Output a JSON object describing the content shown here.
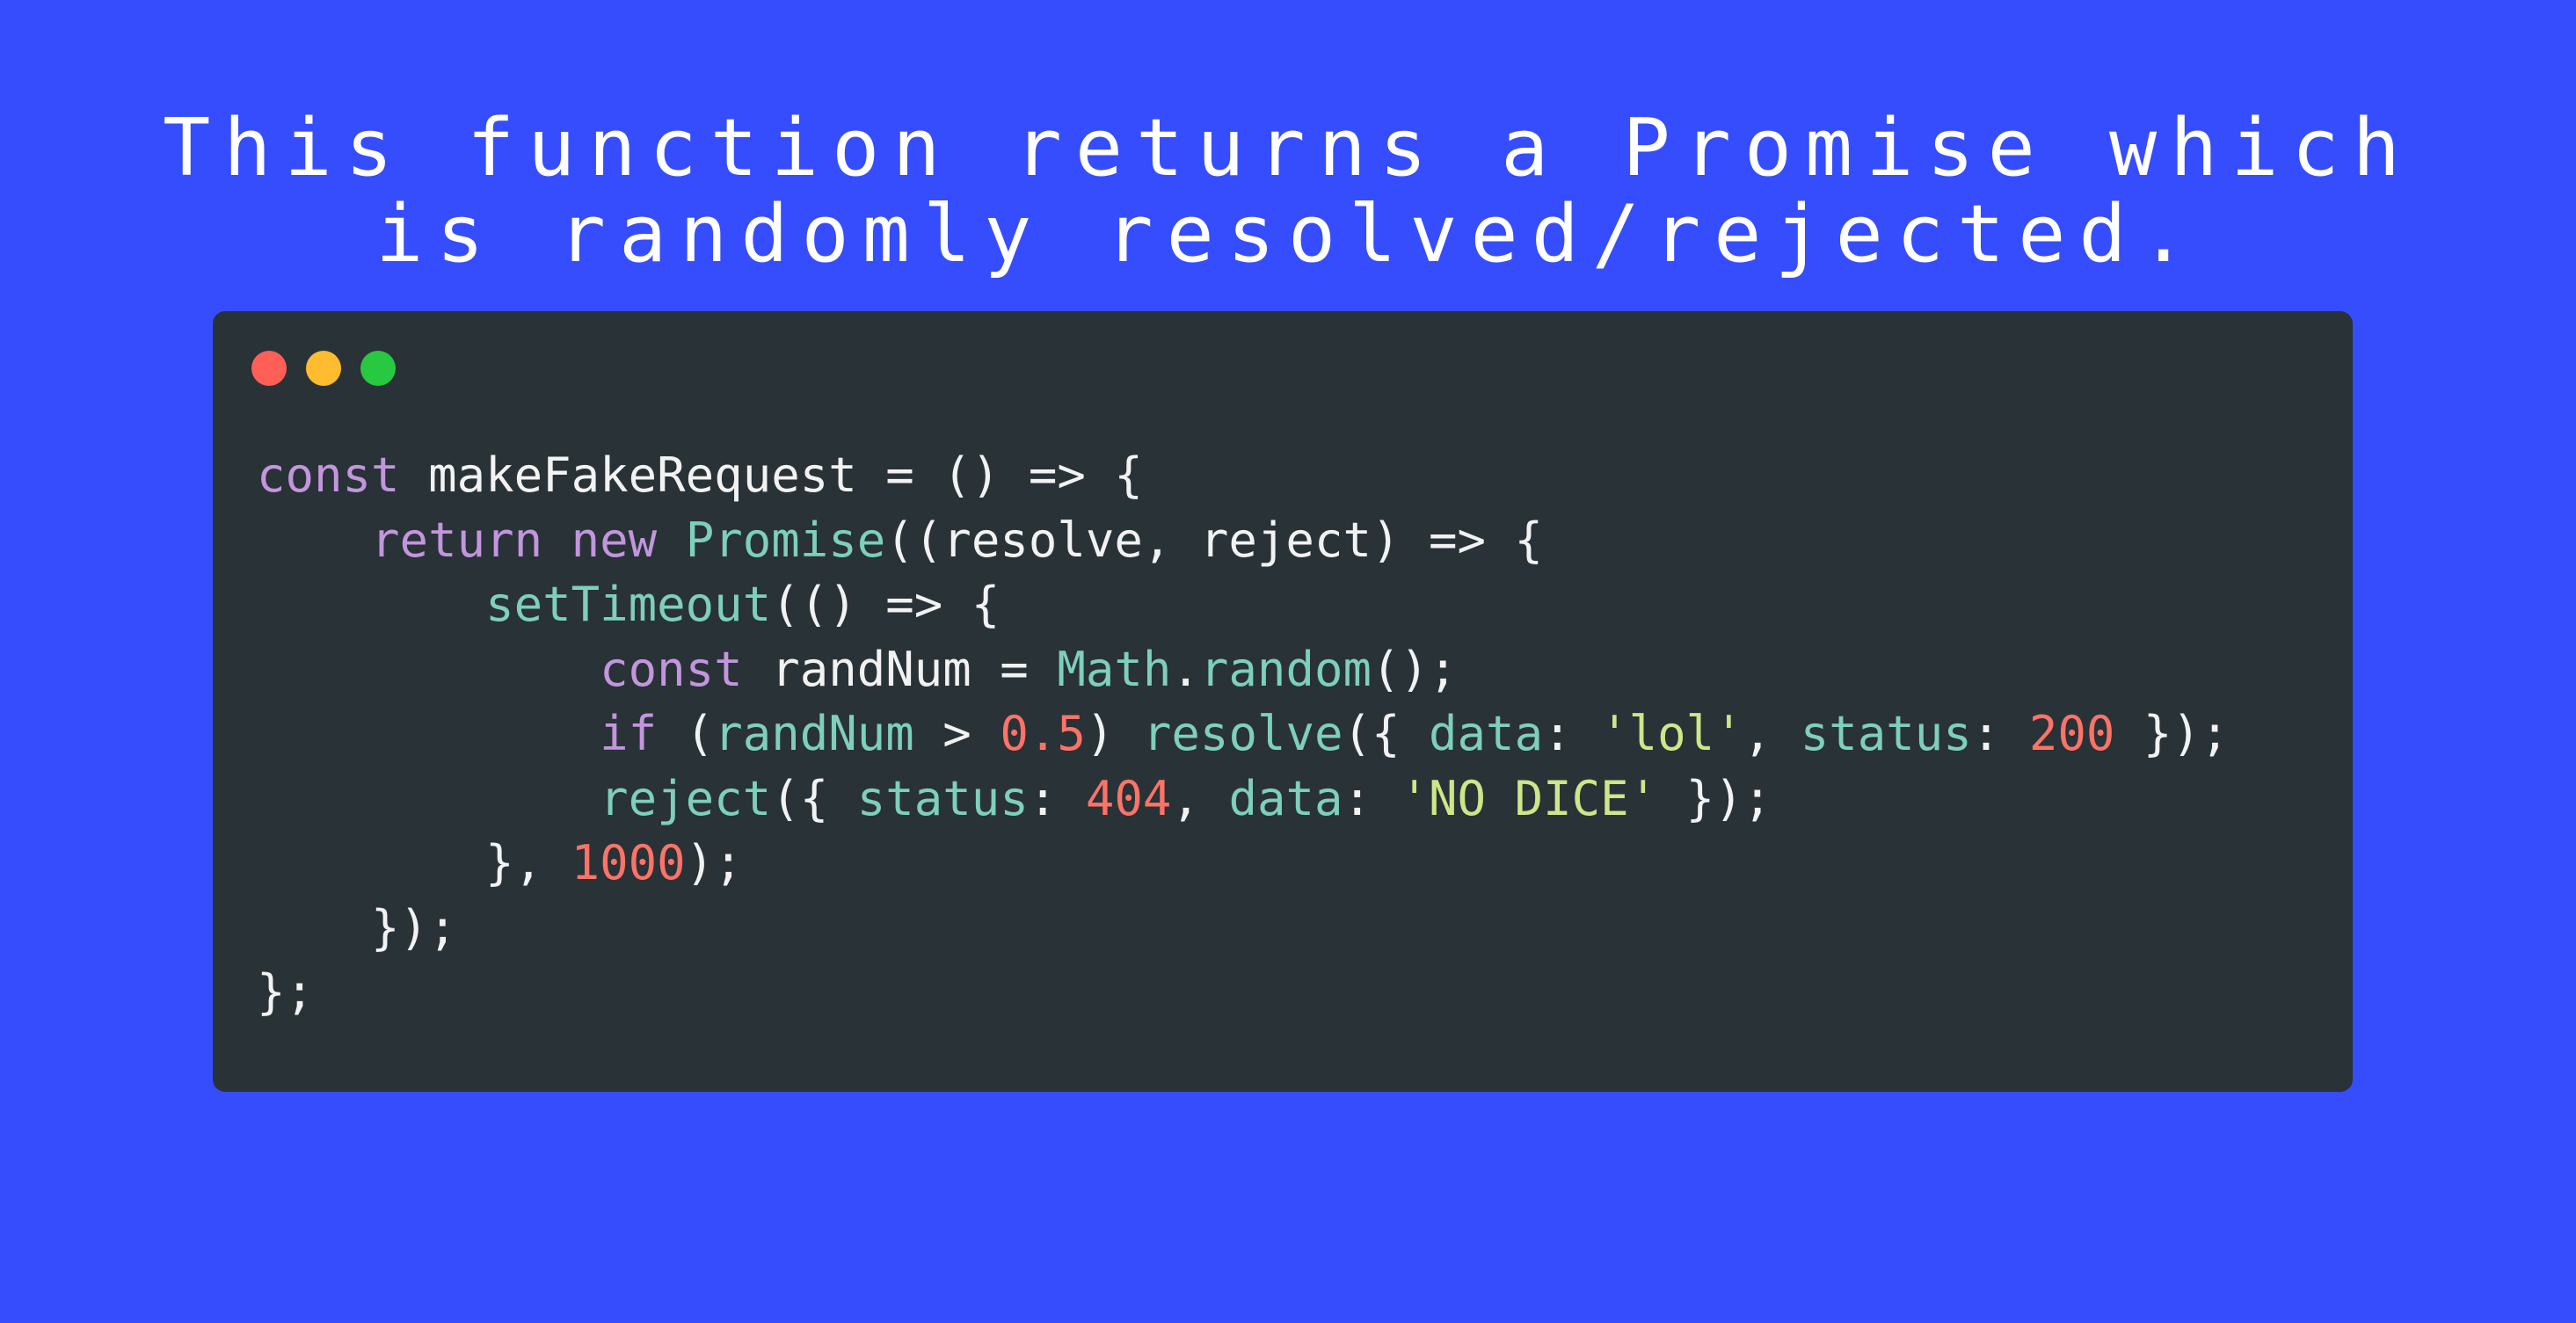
{
  "caption": {
    "line1": "This function returns a Promise which",
    "line2": "is randomly resolved/rejected."
  },
  "window_controls": [
    {
      "name": "close",
      "color": "#ff5f57"
    },
    {
      "name": "minimize",
      "color": "#febc2e"
    },
    {
      "name": "zoom",
      "color": "#28c840"
    }
  ],
  "colors": {
    "background": "#364dfd",
    "code_background": "#293237",
    "keyword": "#c296dd",
    "function": "#7ecfbb",
    "number": "#fc7368",
    "string": "#cfe58a",
    "plain": "#f2f2f2"
  },
  "code": {
    "lines": [
      [
        {
          "t": "const",
          "c": "kw"
        },
        {
          "t": " ",
          "c": "pl"
        },
        {
          "t": "makeFakeRequest",
          "c": "id"
        },
        {
          "t": " = () => {",
          "c": "pl"
        }
      ],
      [
        {
          "t": "    ",
          "c": "pl"
        },
        {
          "t": "return",
          "c": "kw"
        },
        {
          "t": " ",
          "c": "pl"
        },
        {
          "t": "new",
          "c": "kw"
        },
        {
          "t": " ",
          "c": "pl"
        },
        {
          "t": "Promise",
          "c": "fn"
        },
        {
          "t": "((resolve, reject) => {",
          "c": "pl"
        }
      ],
      [
        {
          "t": "        ",
          "c": "pl"
        },
        {
          "t": "setTimeout",
          "c": "fn"
        },
        {
          "t": "(() => {",
          "c": "pl"
        }
      ],
      [
        {
          "t": "            ",
          "c": "pl"
        },
        {
          "t": "const",
          "c": "kw"
        },
        {
          "t": " ",
          "c": "pl"
        },
        {
          "t": "randNum",
          "c": "id"
        },
        {
          "t": " = ",
          "c": "pl"
        },
        {
          "t": "Math",
          "c": "fn"
        },
        {
          "t": ".",
          "c": "pl"
        },
        {
          "t": "random",
          "c": "fn"
        },
        {
          "t": "();",
          "c": "pl"
        }
      ],
      [
        {
          "t": "            ",
          "c": "pl"
        },
        {
          "t": "if",
          "c": "kw"
        },
        {
          "t": " (",
          "c": "pl"
        },
        {
          "t": "randNum",
          "c": "fn"
        },
        {
          "t": " > ",
          "c": "pl"
        },
        {
          "t": "0.5",
          "c": "num"
        },
        {
          "t": ") ",
          "c": "pl"
        },
        {
          "t": "resolve",
          "c": "fn"
        },
        {
          "t": "({ ",
          "c": "pl"
        },
        {
          "t": "data",
          "c": "fn"
        },
        {
          "t": ": ",
          "c": "pl"
        },
        {
          "t": "'lol'",
          "c": "str"
        },
        {
          "t": ", ",
          "c": "pl"
        },
        {
          "t": "status",
          "c": "fn"
        },
        {
          "t": ": ",
          "c": "pl"
        },
        {
          "t": "200",
          "c": "num"
        },
        {
          "t": " });",
          "c": "pl"
        }
      ],
      [
        {
          "t": "            ",
          "c": "pl"
        },
        {
          "t": "reject",
          "c": "fn"
        },
        {
          "t": "({ ",
          "c": "pl"
        },
        {
          "t": "status",
          "c": "fn"
        },
        {
          "t": ": ",
          "c": "pl"
        },
        {
          "t": "404",
          "c": "num"
        },
        {
          "t": ", ",
          "c": "pl"
        },
        {
          "t": "data",
          "c": "fn"
        },
        {
          "t": ": ",
          "c": "pl"
        },
        {
          "t": "'NO DICE'",
          "c": "str"
        },
        {
          "t": " });",
          "c": "pl"
        }
      ],
      [
        {
          "t": "        }, ",
          "c": "pl"
        },
        {
          "t": "1000",
          "c": "num"
        },
        {
          "t": ");",
          "c": "pl"
        }
      ],
      [
        {
          "t": "    });",
          "c": "pl"
        }
      ],
      [
        {
          "t": "};",
          "c": "pl"
        }
      ]
    ]
  }
}
